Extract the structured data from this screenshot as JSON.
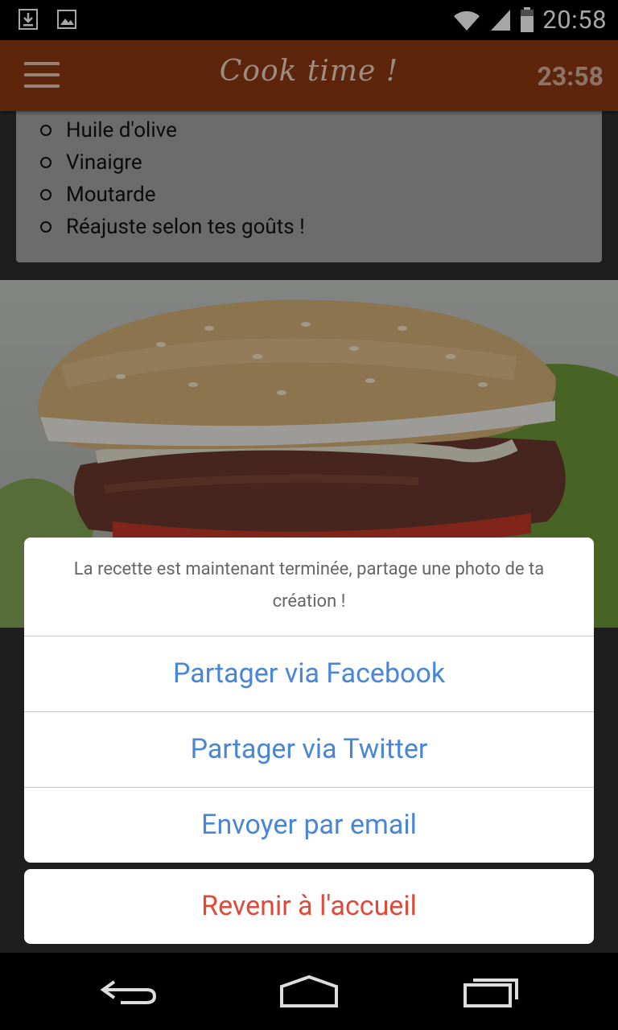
{
  "status_bar": {
    "time": "20:58"
  },
  "app_bar": {
    "title": "Cook time !",
    "timer": "23:58"
  },
  "ingredients": [
    "Huile d'olive",
    "Vinaigre",
    "Moutarde",
    "Réajuste selon tes goûts !"
  ],
  "sheet": {
    "message": "La recette est maintenant terminée, partage une photo de ta création !",
    "facebook": "Partager via Facebook",
    "twitter": "Partager via Twitter",
    "email": "Envoyer par email",
    "cancel": "Revenir à l'accueil"
  },
  "colors": {
    "appbar": "#8f3a12",
    "sheet_action": "#4a86d6",
    "sheet_cancel": "#e04a38"
  }
}
